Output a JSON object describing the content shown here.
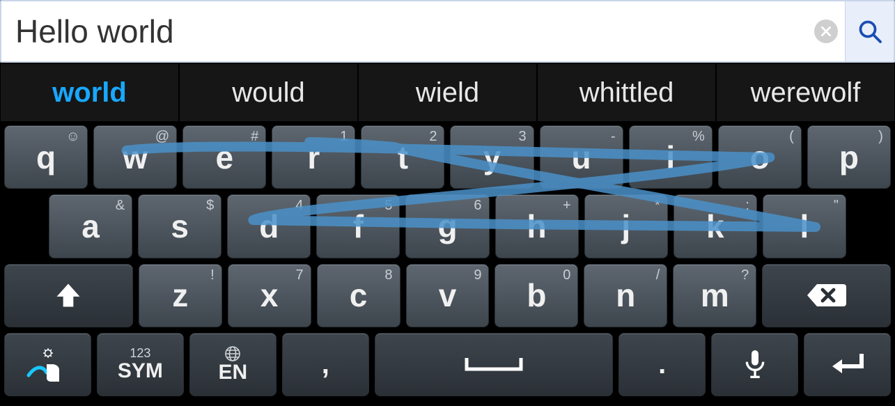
{
  "search": {
    "value": "Hello world",
    "placeholder": ""
  },
  "suggestions": [
    "world",
    "would",
    "wield",
    "whittled",
    "werewolf"
  ],
  "keyboard": {
    "row1": [
      {
        "main": "q",
        "sub": "☺"
      },
      {
        "main": "w",
        "sub": "@"
      },
      {
        "main": "e",
        "sub": "#"
      },
      {
        "main": "r",
        "sub": "1"
      },
      {
        "main": "t",
        "sub": "2"
      },
      {
        "main": "y",
        "sub": "3"
      },
      {
        "main": "u",
        "sub": "-"
      },
      {
        "main": "i",
        "sub": "%"
      },
      {
        "main": "o",
        "sub": "("
      },
      {
        "main": "p",
        "sub": ")"
      }
    ],
    "row2": [
      {
        "main": "a",
        "sub": "&"
      },
      {
        "main": "s",
        "sub": "$"
      },
      {
        "main": "d",
        "sub": "4"
      },
      {
        "main": "f",
        "sub": "5"
      },
      {
        "main": "g",
        "sub": "6"
      },
      {
        "main": "h",
        "sub": "+"
      },
      {
        "main": "j",
        "sub": "*"
      },
      {
        "main": "k",
        "sub": ":"
      },
      {
        "main": "l",
        "sub": "\""
      }
    ],
    "row3": [
      {
        "main": "z",
        "sub": "!"
      },
      {
        "main": "x",
        "sub": "7"
      },
      {
        "main": "c",
        "sub": "8"
      },
      {
        "main": "v",
        "sub": "9"
      },
      {
        "main": "b",
        "sub": "0"
      },
      {
        "main": "n",
        "sub": "/"
      },
      {
        "main": "m",
        "sub": "?"
      }
    ],
    "bottom": {
      "sym_top": "123",
      "sym_bottom": "SYM",
      "lang": "EN",
      "comma": ",",
      "period": "."
    }
  },
  "icons": {
    "clear": "clear-icon",
    "search": "search-icon",
    "shift": "shift-icon",
    "backspace": "backspace-icon",
    "settings": "settings-swipe-icon",
    "globe": "globe-icon",
    "space": "space-icon",
    "mic": "mic-icon",
    "enter": "enter-icon"
  },
  "colors": {
    "accent": "#18a8ff",
    "trace": "#4a90c9"
  }
}
